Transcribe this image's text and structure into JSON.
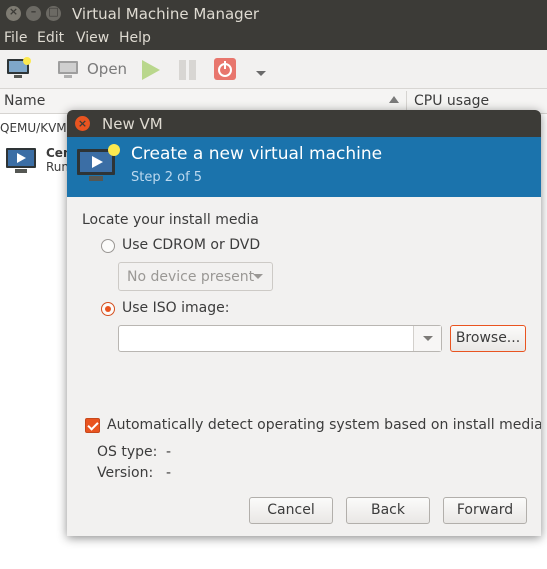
{
  "main_window": {
    "title": "Virtual Machine Manager",
    "menu": [
      "File",
      "Edit",
      "View",
      "Help"
    ],
    "toolbar": {
      "open_label": "Open"
    },
    "columns": {
      "name": "Name",
      "cpu": "CPU usage"
    },
    "group": {
      "label": "QEMU/KVM"
    },
    "vm": {
      "name": "Cen",
      "status": "Run"
    }
  },
  "dialog": {
    "title": "New VM",
    "heading": "Create a new virtual machine",
    "step": "Step 2 of 5",
    "section_label": "Locate your install media",
    "cdrom_label": "Use CDROM or DVD",
    "cdrom_combo": "No device present",
    "iso_label": "Use ISO image:",
    "iso_value": "",
    "browse_label": "Browse...",
    "auto_detect_label": "Automatically detect operating system based on install media",
    "auto_detect_checked": true,
    "os_type_label": "OS type:",
    "os_type_value": "-",
    "version_label": "Version:",
    "version_value": "-",
    "buttons": {
      "cancel": "Cancel",
      "back": "Back",
      "forward": "Forward"
    }
  },
  "colors": {
    "accent": "#e95420",
    "banner": "#1b73ac",
    "titlebar": "#3c3b37",
    "window_bg": "#f2f1f0"
  }
}
